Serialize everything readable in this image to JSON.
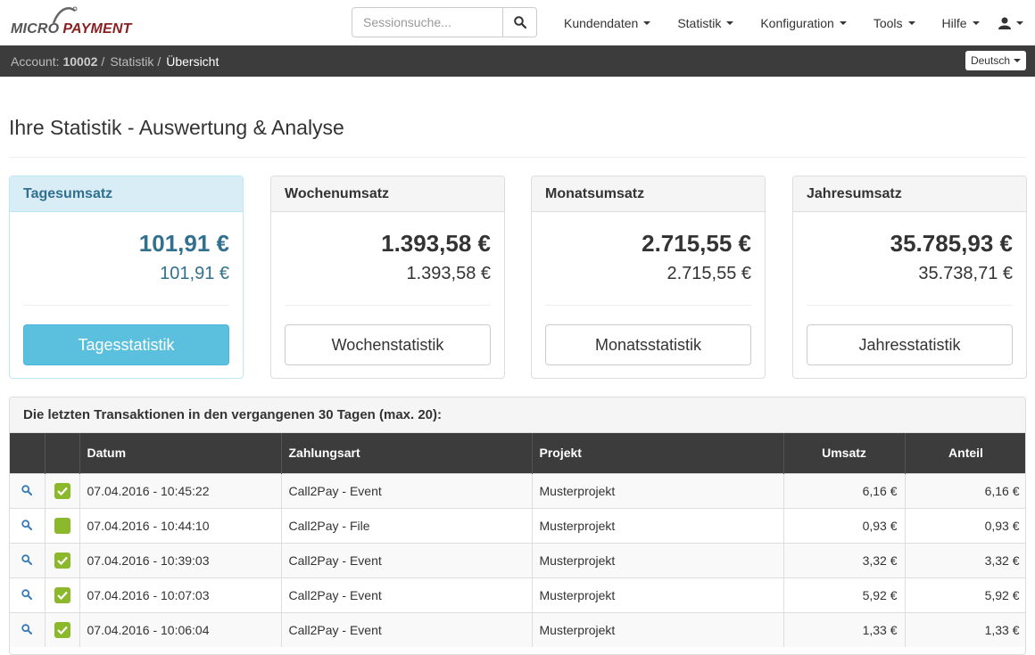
{
  "brand": {
    "micro": "MICRO",
    "payment": "PAYMENT"
  },
  "search": {
    "placeholder": "Sessionsuche..."
  },
  "nav": [
    {
      "label": "Kundendaten"
    },
    {
      "label": "Statistik"
    },
    {
      "label": "Konfiguration"
    },
    {
      "label": "Tools"
    },
    {
      "label": "Hilfe"
    }
  ],
  "breadcrumb": {
    "account_label": "Account:",
    "account_number": "10002",
    "level1": "Statistik",
    "current": "Übersicht",
    "sep": "/"
  },
  "language": "Deutsch",
  "page_title": "Ihre Statistik - Auswertung & Analyse",
  "panels": [
    {
      "title": "Tagesumsatz",
      "big": "101,91 €",
      "small": "101,91 €",
      "button": "Tagesstatistik"
    },
    {
      "title": "Wochenumsatz",
      "big": "1.393,58 €",
      "small": "1.393,58 €",
      "button": "Wochenstatistik"
    },
    {
      "title": "Monatsumsatz",
      "big": "2.715,55 €",
      "small": "2.715,55 €",
      "button": "Monatsstatistik"
    },
    {
      "title": "Jahresumsatz",
      "big": "35.785,93 €",
      "small": "35.738,71 €",
      "button": "Jahresstatistik"
    }
  ],
  "transactions": {
    "title": "Die letzten Transaktionen in den vergangenen 30 Tagen (max. 20):",
    "columns": [
      "Datum",
      "Zahlungsart",
      "Projekt",
      "Umsatz",
      "Anteil"
    ],
    "rows": [
      {
        "date": "07.04.2016 - 10:45:22",
        "method": "Call2Pay - Event",
        "project": "Musterprojekt",
        "amount": "6,16 €",
        "share": "6,16 €",
        "checked": true
      },
      {
        "date": "07.04.2016 - 10:44:10",
        "method": "Call2Pay - File",
        "project": "Musterprojekt",
        "amount": "0,93 €",
        "share": "0,93 €",
        "checked": false
      },
      {
        "date": "07.04.2016 - 10:39:03",
        "method": "Call2Pay - Event",
        "project": "Musterprojekt",
        "amount": "3,32 €",
        "share": "3,32 €",
        "checked": true
      },
      {
        "date": "07.04.2016 - 10:07:03",
        "method": "Call2Pay - Event",
        "project": "Musterprojekt",
        "amount": "5,92 €",
        "share": "5,92 €",
        "checked": true
      },
      {
        "date": "07.04.2016 - 10:06:04",
        "method": "Call2Pay - Event",
        "project": "Musterprojekt",
        "amount": "1,33 €",
        "share": "1,33 €",
        "checked": true
      }
    ]
  },
  "colors": {
    "accent": "#5bc0de",
    "info_text": "#31708f",
    "check_green": "#8cb82b",
    "dark_bar": "#3c3c3c",
    "brand_red": "#8b1f1f"
  }
}
